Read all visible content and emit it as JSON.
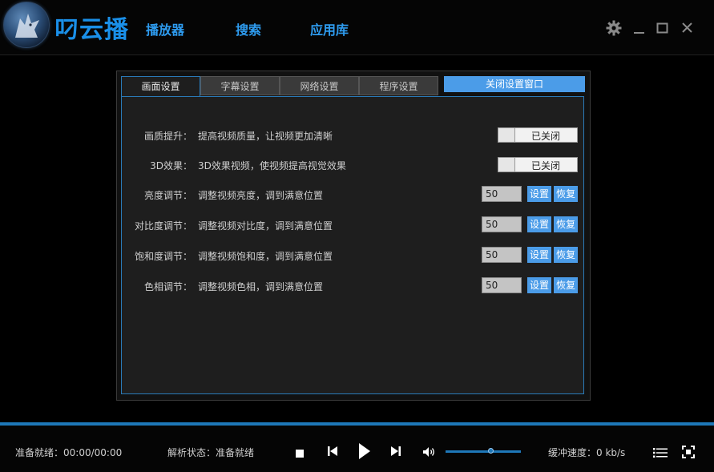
{
  "app": {
    "title": "叼云播"
  },
  "nav": [
    {
      "label": "播放器"
    },
    {
      "label": "搜索"
    },
    {
      "label": "应用库"
    }
  ],
  "window_controls": {
    "settings_icon": "gear-icon",
    "minimize_icon": "minimize-icon",
    "maximize_icon": "maximize-icon",
    "close_icon": "close-icon"
  },
  "settings": {
    "tabs": [
      {
        "label": "画面设置",
        "active": true
      },
      {
        "label": "字幕设置"
      },
      {
        "label": "网络设置"
      },
      {
        "label": "程序设置"
      }
    ],
    "close_label": "关闭设置窗口",
    "rows": [
      {
        "label": "画质提升：",
        "desc": "提高视频质量，让视频更加清晰",
        "toggle": "已关闭"
      },
      {
        "label": "3D效果：",
        "desc": "3D效果视频，使视频提高视觉效果",
        "toggle": "已关闭"
      },
      {
        "label": "亮度调节：",
        "desc": "调整视频亮度，调到满意位置",
        "value": "50",
        "set": "设置",
        "reset": "恢复"
      },
      {
        "label": "对比度调节：",
        "desc": "调整视频对比度，调到满意位置",
        "value": "50",
        "set": "设置",
        "reset": "恢复"
      },
      {
        "label": "饱和度调节：",
        "desc": "调整视频饱和度，调到满意位置",
        "value": "50",
        "set": "设置",
        "reset": "恢复"
      },
      {
        "label": "色相调节：",
        "desc": "调整视频色相，调到满意位置",
        "value": "50",
        "set": "设置",
        "reset": "恢复"
      }
    ]
  },
  "player": {
    "status_time": "准备就绪：00:00/00:00",
    "parse_status": "解析状态：准备就绪",
    "buffer_speed": "缓冲速度：0 kb/s",
    "volume_level": 0.6,
    "colors": {
      "accent": "#1e78b8",
      "button": "#4b9ce8",
      "title": "#1a8fe8"
    }
  }
}
